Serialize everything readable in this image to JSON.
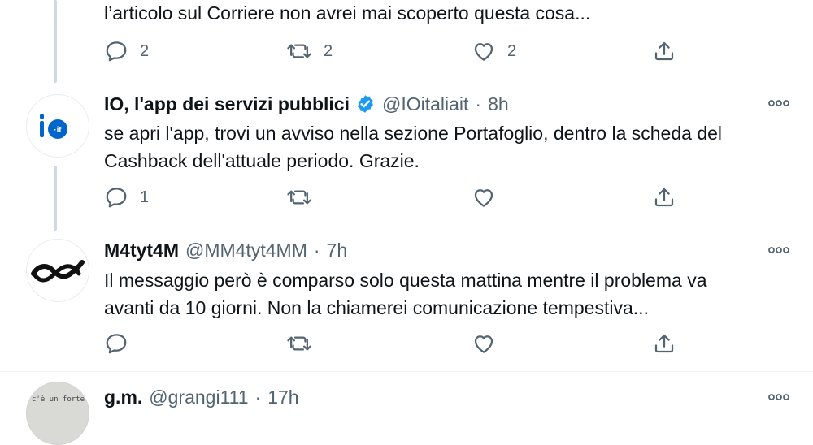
{
  "tweet_prev": {
    "text": "l’articolo sul Corriere non avrei mai scoperto questa cosa...",
    "reply_count": "2",
    "retweet_count": "2",
    "like_count": "2"
  },
  "tweet_io": {
    "name": "IO, l'app dei servizi pubblici",
    "handle": "@IOitaliait",
    "separator": "·",
    "time": "8h",
    "avatar_text": "io",
    "avatar_sub": "·it",
    "text_line1": "se apri l'app, trovi un avviso nella sezione Portafoglio, dentro la scheda del",
    "text_line2": "Cashback dell'attuale periodo. Grazie.",
    "reply_count": "1",
    "brand_color": "#0066cc"
  },
  "tweet_m4": {
    "name": "M4tyt4M",
    "handle": "@MM4tyt4MM",
    "separator": "·",
    "time": "7h",
    "text_line1": "Il messaggio però è comparso solo questa mattina mentre il problema va",
    "text_line2": "avanti da 10 giorni. Non la chiamerei comunicazione tempestiva..."
  },
  "tweet_gm": {
    "name": "g.m.",
    "handle": "@grangi111",
    "separator": "·",
    "time": "17h",
    "avatar_text": "c'è un forte"
  },
  "icons": [
    "reply-icon",
    "retweet-icon",
    "like-icon",
    "share-icon",
    "more-icon",
    "verified-icon"
  ],
  "colors": {
    "icon": "#536471",
    "verified": "#1d9bf0",
    "thread_line": "#cfd9de"
  }
}
